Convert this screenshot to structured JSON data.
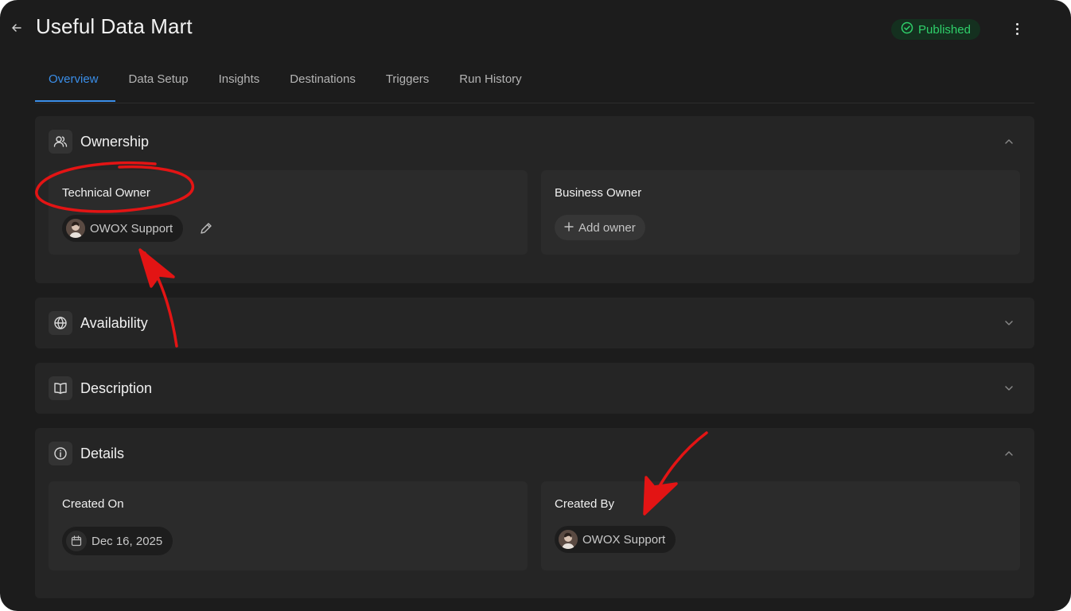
{
  "header": {
    "title": "Useful Data Mart",
    "status": "Published"
  },
  "tabs": [
    {
      "label": "Overview",
      "active": true
    },
    {
      "label": "Data Setup"
    },
    {
      "label": "Insights"
    },
    {
      "label": "Destinations"
    },
    {
      "label": "Triggers"
    },
    {
      "label": "Run History"
    }
  ],
  "sections": {
    "ownership": {
      "title": "Ownership",
      "technical_owner": {
        "label": "Technical Owner",
        "name": "OWOX Support"
      },
      "business_owner": {
        "label": "Business Owner",
        "add_label": "Add owner"
      }
    },
    "availability": {
      "title": "Availability"
    },
    "description": {
      "title": "Description"
    },
    "details": {
      "title": "Details",
      "created_on": {
        "label": "Created On",
        "value": "Dec 16, 2025"
      },
      "created_by": {
        "label": "Created By",
        "name": "OWOX Support"
      }
    }
  },
  "colors": {
    "background": "#1c1c1c",
    "accent": "#3a8ee8",
    "published": "#2fd06a",
    "annotation": "#e31414"
  }
}
